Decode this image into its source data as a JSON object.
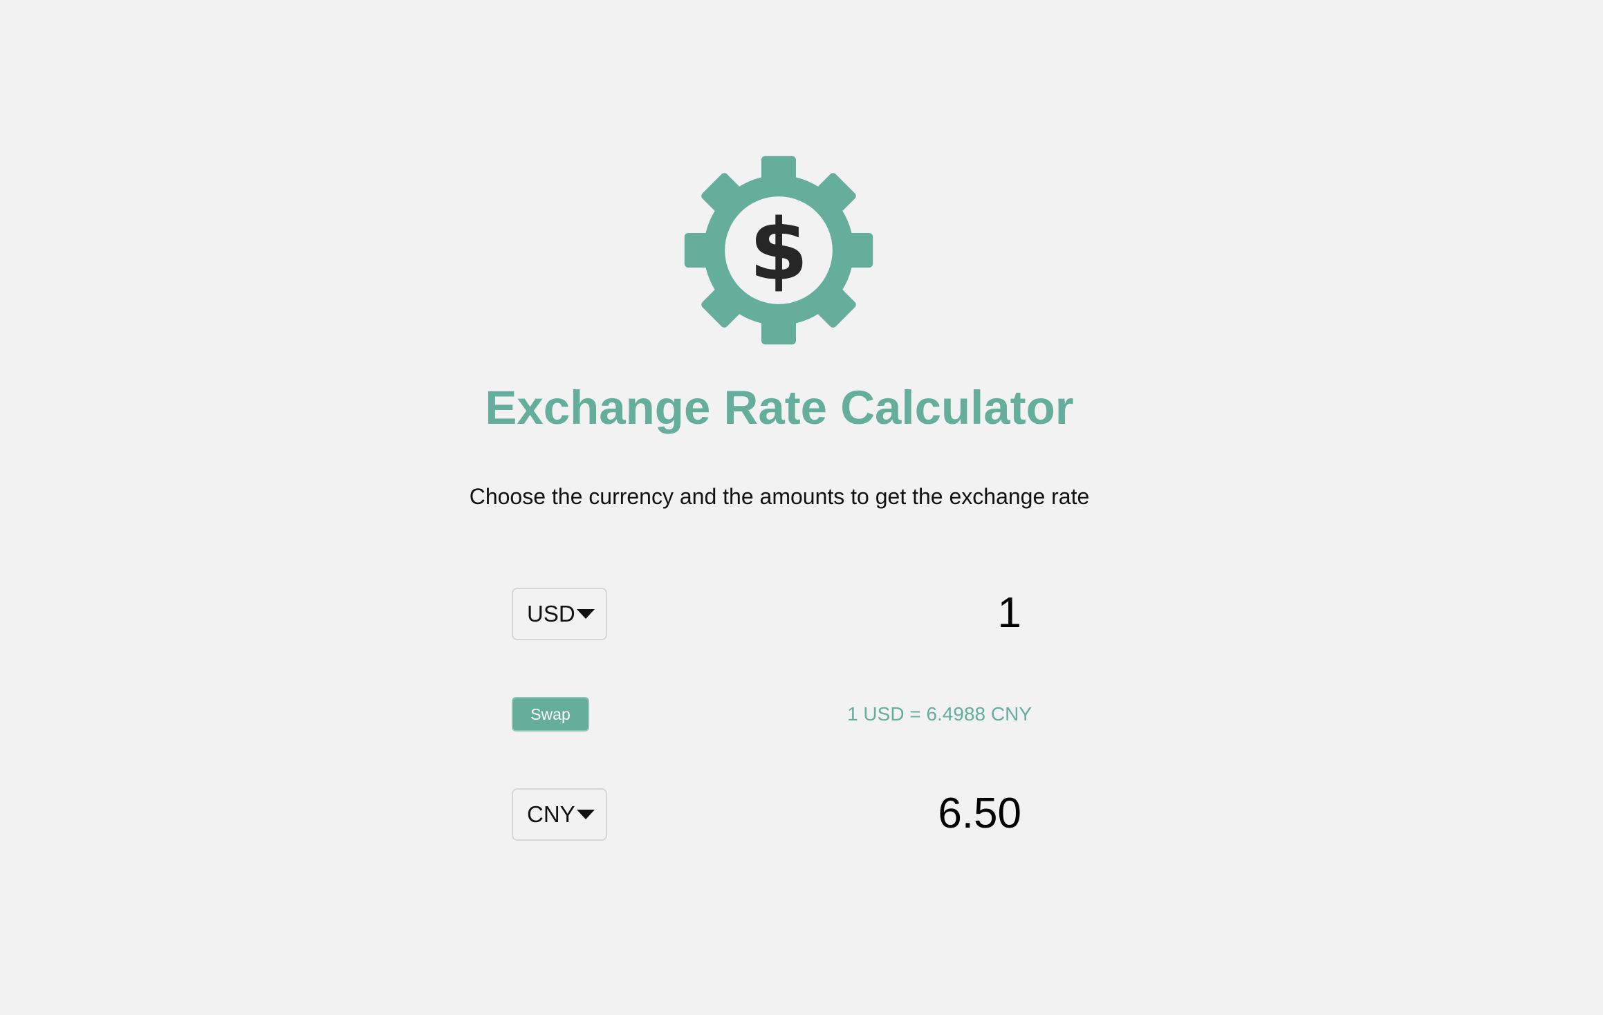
{
  "app": {
    "title": "Exchange Rate Calculator",
    "subtitle": "Choose the currency and the amounts to get the exchange rate",
    "logo_icon": "gear-dollar-icon"
  },
  "colors": {
    "accent": "#64ae9b",
    "background": "#f2f2f2",
    "dollar": "#262626"
  },
  "currency_one": {
    "selected": "USD",
    "amount": "1"
  },
  "swap": {
    "label": "Swap"
  },
  "rate_text": "1 USD = 6.4988 CNY",
  "currency_two": {
    "selected": "CNY",
    "amount": "6.50"
  }
}
